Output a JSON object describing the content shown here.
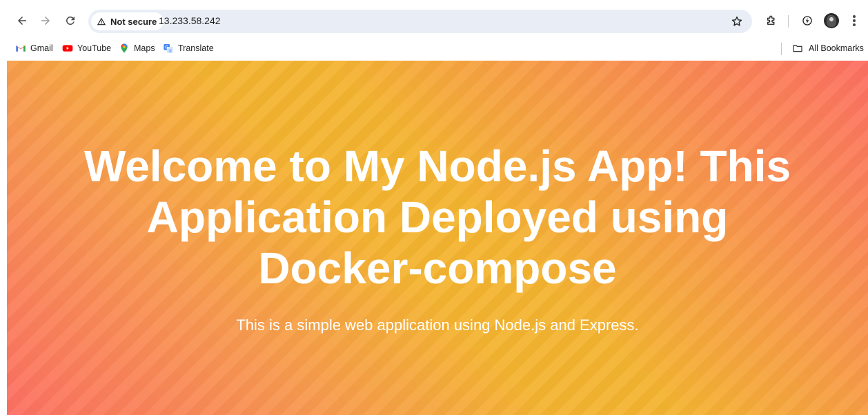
{
  "toolbar": {
    "security_label": "Not secure",
    "url": "13.233.58.242"
  },
  "bookmarks": {
    "items": [
      {
        "label": "Gmail"
      },
      {
        "label": "YouTube"
      },
      {
        "label": "Maps"
      },
      {
        "label": "Translate"
      }
    ],
    "all_bookmarks_label": "All Bookmarks"
  },
  "page": {
    "heading": "Welcome to My Node.js App! This Application Deployed using Docker-compose",
    "subtitle": "This is a simple web application using Node.js and Express."
  },
  "colors": {
    "gradient_edge": "#fd6f63",
    "gradient_center": "#f4b431",
    "text": "#ffffff",
    "omnibox_bg": "#e9eef6"
  }
}
